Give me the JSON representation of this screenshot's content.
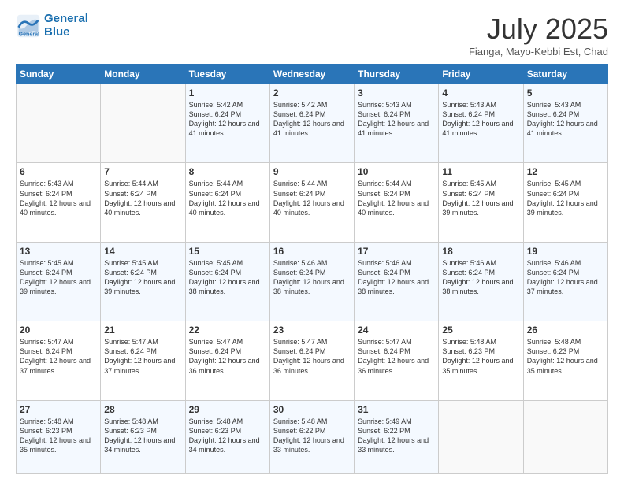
{
  "header": {
    "logo_line1": "General",
    "logo_line2": "Blue",
    "month": "July 2025",
    "location": "Fianga, Mayo-Kebbi Est, Chad"
  },
  "weekdays": [
    "Sunday",
    "Monday",
    "Tuesday",
    "Wednesday",
    "Thursday",
    "Friday",
    "Saturday"
  ],
  "weeks": [
    [
      {
        "day": "",
        "text": ""
      },
      {
        "day": "",
        "text": ""
      },
      {
        "day": "1",
        "text": "Sunrise: 5:42 AM\nSunset: 6:24 PM\nDaylight: 12 hours and 41 minutes."
      },
      {
        "day": "2",
        "text": "Sunrise: 5:42 AM\nSunset: 6:24 PM\nDaylight: 12 hours and 41 minutes."
      },
      {
        "day": "3",
        "text": "Sunrise: 5:43 AM\nSunset: 6:24 PM\nDaylight: 12 hours and 41 minutes."
      },
      {
        "day": "4",
        "text": "Sunrise: 5:43 AM\nSunset: 6:24 PM\nDaylight: 12 hours and 41 minutes."
      },
      {
        "day": "5",
        "text": "Sunrise: 5:43 AM\nSunset: 6:24 PM\nDaylight: 12 hours and 41 minutes."
      }
    ],
    [
      {
        "day": "6",
        "text": "Sunrise: 5:43 AM\nSunset: 6:24 PM\nDaylight: 12 hours and 40 minutes."
      },
      {
        "day": "7",
        "text": "Sunrise: 5:44 AM\nSunset: 6:24 PM\nDaylight: 12 hours and 40 minutes."
      },
      {
        "day": "8",
        "text": "Sunrise: 5:44 AM\nSunset: 6:24 PM\nDaylight: 12 hours and 40 minutes."
      },
      {
        "day": "9",
        "text": "Sunrise: 5:44 AM\nSunset: 6:24 PM\nDaylight: 12 hours and 40 minutes."
      },
      {
        "day": "10",
        "text": "Sunrise: 5:44 AM\nSunset: 6:24 PM\nDaylight: 12 hours and 40 minutes."
      },
      {
        "day": "11",
        "text": "Sunrise: 5:45 AM\nSunset: 6:24 PM\nDaylight: 12 hours and 39 minutes."
      },
      {
        "day": "12",
        "text": "Sunrise: 5:45 AM\nSunset: 6:24 PM\nDaylight: 12 hours and 39 minutes."
      }
    ],
    [
      {
        "day": "13",
        "text": "Sunrise: 5:45 AM\nSunset: 6:24 PM\nDaylight: 12 hours and 39 minutes."
      },
      {
        "day": "14",
        "text": "Sunrise: 5:45 AM\nSunset: 6:24 PM\nDaylight: 12 hours and 39 minutes."
      },
      {
        "day": "15",
        "text": "Sunrise: 5:45 AM\nSunset: 6:24 PM\nDaylight: 12 hours and 38 minutes."
      },
      {
        "day": "16",
        "text": "Sunrise: 5:46 AM\nSunset: 6:24 PM\nDaylight: 12 hours and 38 minutes."
      },
      {
        "day": "17",
        "text": "Sunrise: 5:46 AM\nSunset: 6:24 PM\nDaylight: 12 hours and 38 minutes."
      },
      {
        "day": "18",
        "text": "Sunrise: 5:46 AM\nSunset: 6:24 PM\nDaylight: 12 hours and 38 minutes."
      },
      {
        "day": "19",
        "text": "Sunrise: 5:46 AM\nSunset: 6:24 PM\nDaylight: 12 hours and 37 minutes."
      }
    ],
    [
      {
        "day": "20",
        "text": "Sunrise: 5:47 AM\nSunset: 6:24 PM\nDaylight: 12 hours and 37 minutes."
      },
      {
        "day": "21",
        "text": "Sunrise: 5:47 AM\nSunset: 6:24 PM\nDaylight: 12 hours and 37 minutes."
      },
      {
        "day": "22",
        "text": "Sunrise: 5:47 AM\nSunset: 6:24 PM\nDaylight: 12 hours and 36 minutes."
      },
      {
        "day": "23",
        "text": "Sunrise: 5:47 AM\nSunset: 6:24 PM\nDaylight: 12 hours and 36 minutes."
      },
      {
        "day": "24",
        "text": "Sunrise: 5:47 AM\nSunset: 6:24 PM\nDaylight: 12 hours and 36 minutes."
      },
      {
        "day": "25",
        "text": "Sunrise: 5:48 AM\nSunset: 6:23 PM\nDaylight: 12 hours and 35 minutes."
      },
      {
        "day": "26",
        "text": "Sunrise: 5:48 AM\nSunset: 6:23 PM\nDaylight: 12 hours and 35 minutes."
      }
    ],
    [
      {
        "day": "27",
        "text": "Sunrise: 5:48 AM\nSunset: 6:23 PM\nDaylight: 12 hours and 35 minutes."
      },
      {
        "day": "28",
        "text": "Sunrise: 5:48 AM\nSunset: 6:23 PM\nDaylight: 12 hours and 34 minutes."
      },
      {
        "day": "29",
        "text": "Sunrise: 5:48 AM\nSunset: 6:23 PM\nDaylight: 12 hours and 34 minutes."
      },
      {
        "day": "30",
        "text": "Sunrise: 5:48 AM\nSunset: 6:22 PM\nDaylight: 12 hours and 33 minutes."
      },
      {
        "day": "31",
        "text": "Sunrise: 5:49 AM\nSunset: 6:22 PM\nDaylight: 12 hours and 33 minutes."
      },
      {
        "day": "",
        "text": ""
      },
      {
        "day": "",
        "text": ""
      }
    ]
  ]
}
